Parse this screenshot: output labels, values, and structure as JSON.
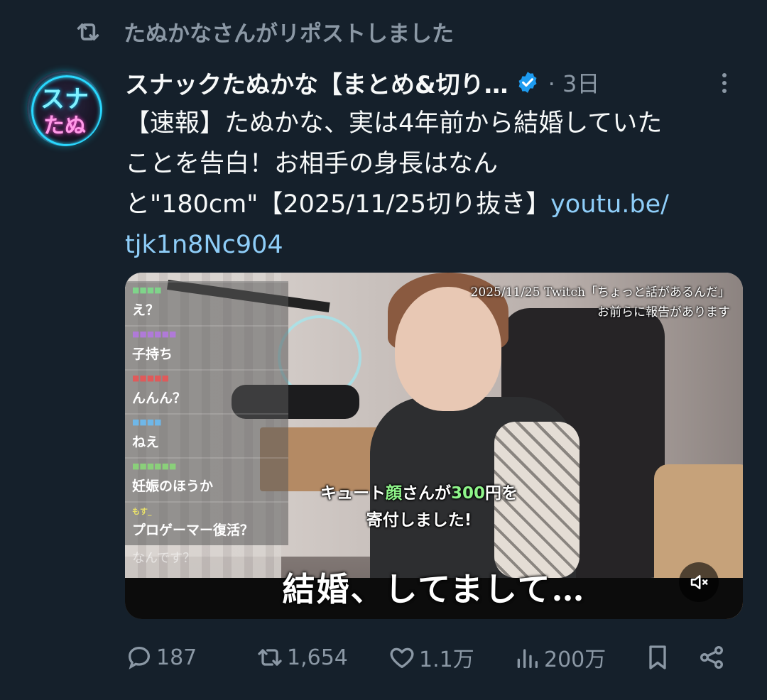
{
  "repost": {
    "icon": "repost-icon",
    "text": "たぬかなさんがリポストしました"
  },
  "author": {
    "avatar_top": "スナ",
    "avatar_bottom": "たぬ",
    "name": "スナックたぬかな【まとめ&切り…",
    "verified_icon": "verified-badge-icon",
    "time": "· 3日"
  },
  "tweet": {
    "text_line1": "【速報】たぬかな、実は4年前から結婚していた",
    "text_line2": "ことを告白！お相手の身長はなん",
    "text_line3_prefix": "と\"180cm\"【2025/11/25切り抜き】",
    "link_part1": "youtu.be/",
    "link_part2": "tjk1n8Nc904"
  },
  "media": {
    "date_line1": "2025/11/25 Twitch「ちょっと話があるんだ」",
    "date_line2": "お前らに報告があります",
    "donation_pre": "キュート",
    "donation_green1": "顔",
    "donation_mid": "さんが",
    "donation_green2": "300",
    "donation_post": "円を",
    "donation_line2": "寄付しました!",
    "subtitle": "結婚、してまして…",
    "mute_icon": "volume-muted-icon",
    "chat": [
      {
        "user": "■■■■",
        "msg": "え？",
        "color": "#7fd48a"
      },
      {
        "user": "■■■■■■",
        "msg": "子持ち",
        "color": "#b07ad8"
      },
      {
        "user": "■■■■■",
        "msg": "んんん？",
        "color": "#e05a5a"
      },
      {
        "user": "■■■■",
        "msg": "ねえ",
        "color": "#6fb7e8"
      },
      {
        "user": "■■■■■■",
        "msg": "妊娠のほうか",
        "color": "#8ad07a"
      },
      {
        "user": "もす_",
        "msg": "プロゲーマー復活？",
        "color": "#e8e06a"
      }
    ],
    "chat_fade": "なんです？"
  },
  "actions": {
    "reply_count": "187",
    "repost_count": "1,654",
    "like_count": "1.1万",
    "views_count": "200万"
  },
  "colors": {
    "background": "#15202b",
    "secondary_text": "#8b98a5",
    "link": "#8ecdf8",
    "verified": "#1d9bf0"
  }
}
